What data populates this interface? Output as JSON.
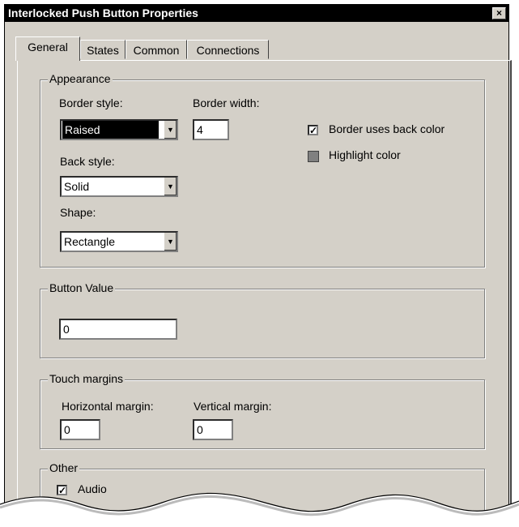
{
  "window": {
    "title": "Interlocked Push Button Properties",
    "close_glyph": "×"
  },
  "tabs": [
    {
      "label": "General",
      "active": true
    },
    {
      "label": "States",
      "active": false
    },
    {
      "label": "Common",
      "active": false
    },
    {
      "label": "Connections",
      "active": false
    }
  ],
  "appearance": {
    "legend": "Appearance",
    "border_style_label": "Border style:",
    "border_style_value": "Raised",
    "border_width_label": "Border width:",
    "border_width_value": "4",
    "back_style_label": "Back style:",
    "back_style_value": "Solid",
    "shape_label": "Shape:",
    "shape_value": "Rectangle",
    "border_uses_back_color_label": "Border uses back color",
    "border_uses_back_color_checked": true,
    "highlight_color_label": "Highlight color",
    "highlight_color": "#808080"
  },
  "button_value": {
    "legend": "Button Value",
    "value": "0"
  },
  "touch_margins": {
    "legend": "Touch margins",
    "horizontal_label": "Horizontal  margin:",
    "horizontal_value": "0",
    "vertical_label": "Vertical margin:",
    "vertical_value": "0"
  },
  "other": {
    "legend": "Other",
    "audio_label": "Audio",
    "audio_checked": true
  },
  "icons": {
    "dropdown": "chevron-down-icon",
    "check": "checkmark-icon"
  },
  "colors": {
    "dialog_bg": "#d4d0c8",
    "titlebar_bg": "#000000",
    "titlebar_text": "#ffffff"
  }
}
